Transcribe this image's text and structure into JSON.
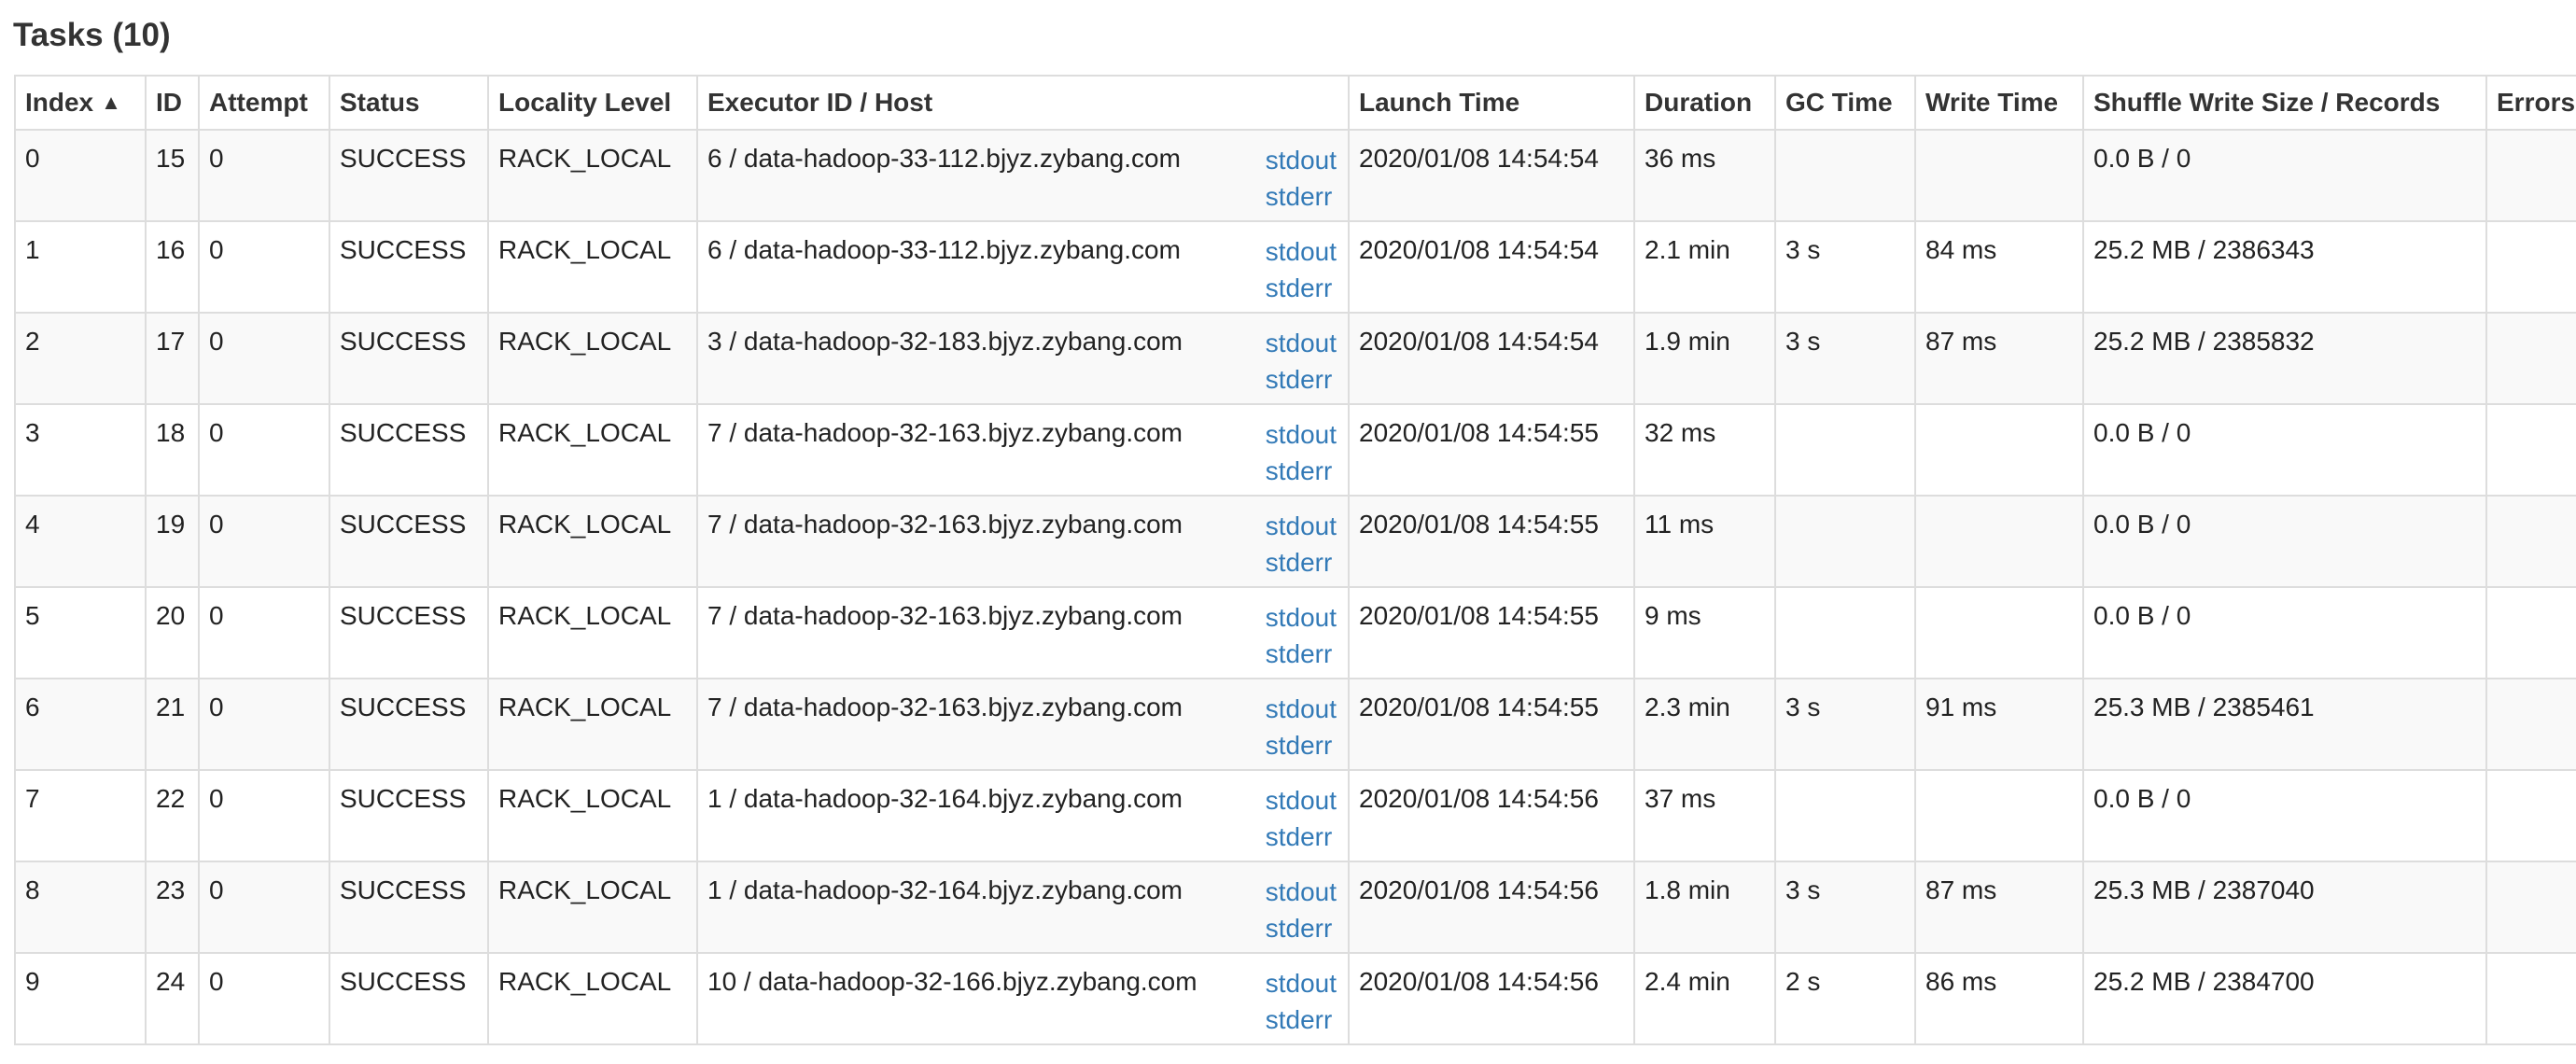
{
  "page": {
    "title": "Tasks (10)"
  },
  "columns": [
    {
      "key": "index",
      "label": "Index",
      "sort_indicator": "▲"
    },
    {
      "key": "id",
      "label": "ID"
    },
    {
      "key": "attempt",
      "label": "Attempt"
    },
    {
      "key": "status",
      "label": "Status"
    },
    {
      "key": "locality",
      "label": "Locality Level"
    },
    {
      "key": "executor",
      "label": "Executor ID / Host"
    },
    {
      "key": "launch",
      "label": "Launch Time"
    },
    {
      "key": "duration",
      "label": "Duration"
    },
    {
      "key": "gc",
      "label": "GC Time"
    },
    {
      "key": "write",
      "label": "Write Time"
    },
    {
      "key": "shuffle",
      "label": "Shuffle Write Size / Records"
    },
    {
      "key": "errors",
      "label": "Errors"
    }
  ],
  "log_links": {
    "stdout": "stdout",
    "stderr": "stderr"
  },
  "colors": {
    "link": "#337ab7",
    "border": "#dddddd",
    "stripe": "#f9f9f9"
  },
  "rows": [
    {
      "index": "0",
      "id": "15",
      "attempt": "0",
      "status": "SUCCESS",
      "locality": "RACK_LOCAL",
      "executor": "6 / data-hadoop-33-112.bjyz.zybang.com",
      "launch": "2020/01/08 14:54:54",
      "duration": "36 ms",
      "gc": "",
      "write": "",
      "shuffle": "0.0 B / 0",
      "errors": ""
    },
    {
      "index": "1",
      "id": "16",
      "attempt": "0",
      "status": "SUCCESS",
      "locality": "RACK_LOCAL",
      "executor": "6 / data-hadoop-33-112.bjyz.zybang.com",
      "launch": "2020/01/08 14:54:54",
      "duration": "2.1 min",
      "gc": "3 s",
      "write": "84 ms",
      "shuffle": "25.2 MB / 2386343",
      "errors": ""
    },
    {
      "index": "2",
      "id": "17",
      "attempt": "0",
      "status": "SUCCESS",
      "locality": "RACK_LOCAL",
      "executor": "3 / data-hadoop-32-183.bjyz.zybang.com",
      "launch": "2020/01/08 14:54:54",
      "duration": "1.9 min",
      "gc": "3 s",
      "write": "87 ms",
      "shuffle": "25.2 MB / 2385832",
      "errors": ""
    },
    {
      "index": "3",
      "id": "18",
      "attempt": "0",
      "status": "SUCCESS",
      "locality": "RACK_LOCAL",
      "executor": "7 / data-hadoop-32-163.bjyz.zybang.com",
      "launch": "2020/01/08 14:54:55",
      "duration": "32 ms",
      "gc": "",
      "write": "",
      "shuffle": "0.0 B / 0",
      "errors": ""
    },
    {
      "index": "4",
      "id": "19",
      "attempt": "0",
      "status": "SUCCESS",
      "locality": "RACK_LOCAL",
      "executor": "7 / data-hadoop-32-163.bjyz.zybang.com",
      "launch": "2020/01/08 14:54:55",
      "duration": "11 ms",
      "gc": "",
      "write": "",
      "shuffle": "0.0 B / 0",
      "errors": ""
    },
    {
      "index": "5",
      "id": "20",
      "attempt": "0",
      "status": "SUCCESS",
      "locality": "RACK_LOCAL",
      "executor": "7 / data-hadoop-32-163.bjyz.zybang.com",
      "launch": "2020/01/08 14:54:55",
      "duration": "9 ms",
      "gc": "",
      "write": "",
      "shuffle": "0.0 B / 0",
      "errors": ""
    },
    {
      "index": "6",
      "id": "21",
      "attempt": "0",
      "status": "SUCCESS",
      "locality": "RACK_LOCAL",
      "executor": "7 / data-hadoop-32-163.bjyz.zybang.com",
      "launch": "2020/01/08 14:54:55",
      "duration": "2.3 min",
      "gc": "3 s",
      "write": "91 ms",
      "shuffle": "25.3 MB / 2385461",
      "errors": ""
    },
    {
      "index": "7",
      "id": "22",
      "attempt": "0",
      "status": "SUCCESS",
      "locality": "RACK_LOCAL",
      "executor": "1 / data-hadoop-32-164.bjyz.zybang.com",
      "launch": "2020/01/08 14:54:56",
      "duration": "37 ms",
      "gc": "",
      "write": "",
      "shuffle": "0.0 B / 0",
      "errors": ""
    },
    {
      "index": "8",
      "id": "23",
      "attempt": "0",
      "status": "SUCCESS",
      "locality": "RACK_LOCAL",
      "executor": "1 / data-hadoop-32-164.bjyz.zybang.com",
      "launch": "2020/01/08 14:54:56",
      "duration": "1.8 min",
      "gc": "3 s",
      "write": "87 ms",
      "shuffle": "25.3 MB / 2387040",
      "errors": ""
    },
    {
      "index": "9",
      "id": "24",
      "attempt": "0",
      "status": "SUCCESS",
      "locality": "RACK_LOCAL",
      "executor": "10 / data-hadoop-32-166.bjyz.zybang.com",
      "launch": "2020/01/08 14:54:56",
      "duration": "2.4 min",
      "gc": "2 s",
      "write": "86 ms",
      "shuffle": "25.2 MB / 2384700",
      "errors": ""
    }
  ]
}
